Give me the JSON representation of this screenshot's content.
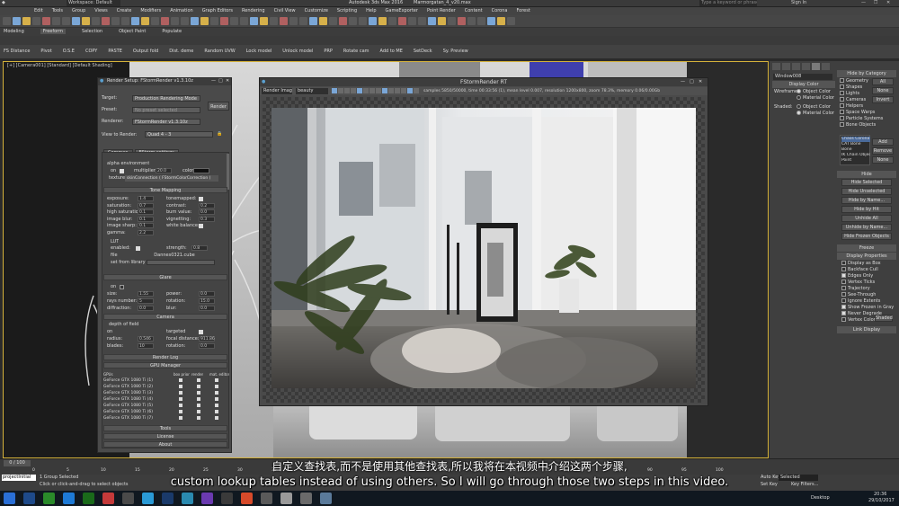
{
  "app": {
    "title": "Autodesk 3ds Max 2016",
    "filename": "Marmorgatan_4_v20.max",
    "workspace": "Workspace: Default",
    "search_placeholder": "Type a keyword or phrase",
    "sign_in": "Sign In"
  },
  "menu": [
    "Edit",
    "Tools",
    "Group",
    "Views",
    "Create",
    "Modifiers",
    "Animation",
    "Graph Editors",
    "Rendering",
    "Civil View",
    "Customize",
    "Scripting",
    "Help",
    "GameExporter",
    "Point Render",
    "Content",
    "Corona",
    "Forest"
  ],
  "ribbon_tabs": [
    "Modeling",
    "Freeform",
    "Selection",
    "Object Paint",
    "Populate"
  ],
  "ribbon_tools": [
    "FS Distance",
    "Pivot",
    "O.S.E",
    "COPY",
    "PASTE",
    "Output fold",
    "Dist. deme",
    "Random UVW",
    "Lock model",
    "Unlock model",
    "PRP",
    "Rotate cam",
    "Add to ME",
    "SetDeck",
    "Sy. Preview"
  ],
  "viewport": {
    "label": "[+] [Camera001] [Standard] [Default Shading]"
  },
  "render_setup": {
    "title": "Render Setup: FStormRender v1.3.10z",
    "target_label": "Target:",
    "target_value": "Production Rendering Mode",
    "preset_label": "Preset:",
    "preset_value": "No preset selected",
    "renderer_label": "Renderer:",
    "renderer_value": "FStormRender v1.3.10z",
    "render_button": "Render",
    "view_label": "View to Render:",
    "view_value": "Quad 4 - 3",
    "tabs": [
      "Common",
      "FStorm settings",
      "Render Elements"
    ],
    "alpha_env": "alpha environment",
    "alpha_on": "on",
    "multiplier_label": "multiplier:",
    "multiplier_value": "20.0",
    "color_label": "color:",
    "texture_label": "texture",
    "texture_value": "skinConnection ( FStormColorCorrection )",
    "tone_mapping": "Tone Mapping",
    "tone_left": [
      {
        "label": "exposure:",
        "value": "1.4"
      },
      {
        "label": "saturation:",
        "value": "0.7"
      },
      {
        "label": "high saturation:",
        "value": "0.1"
      },
      {
        "label": "image blur:",
        "value": "0.1"
      },
      {
        "label": "image sharp:",
        "value": "0.1"
      },
      {
        "label": "gamma:",
        "value": "2.2"
      }
    ],
    "tone_right": [
      {
        "label": "tonemapped:",
        "value": ""
      },
      {
        "label": "contrast:",
        "value": "0.2"
      },
      {
        "label": "burn value:",
        "value": "0.0"
      },
      {
        "label": "vignetting:",
        "value": "0.3"
      },
      {
        "label": "white balance:",
        "value": ""
      }
    ],
    "lut": "LUT",
    "lut_enabled": "enabled:",
    "lut_strength": "strength:",
    "lut_strength_value": "0.8",
    "lut_file_label": "file",
    "lut_file_value": "Dannes0321.cube",
    "lut_library": "set from library",
    "glare": "Glare",
    "glare_on": "on",
    "glare_left": [
      {
        "label": "size:",
        "value": "1.55"
      },
      {
        "label": "rays number:",
        "value": "5"
      },
      {
        "label": "diffraction:",
        "value": "0.0"
      }
    ],
    "glare_right": [
      {
        "label": "power:",
        "value": "0.0"
      },
      {
        "label": "rotation:",
        "value": "15.0"
      },
      {
        "label": "blur:",
        "value": "0.0"
      }
    ],
    "camera": "Camera",
    "dof": "depth of field",
    "cam_left": [
      {
        "label": "on",
        "value": ""
      },
      {
        "label": "radius:",
        "value": "0.546"
      },
      {
        "label": "blades:",
        "value": "10"
      }
    ],
    "cam_right": [
      {
        "label": "targeted",
        "value": ""
      },
      {
        "label": "focal distance:",
        "value": "911.86"
      },
      {
        "label": "rotation:",
        "value": "0.0"
      }
    ],
    "render_log": "Render Log",
    "gpu_manager": "GPU Manager",
    "gpu_header": [
      "GPUs",
      "box prior",
      "render",
      "mat. editor"
    ],
    "gpus": [
      "GeForce GTX 1080 Ti (1)",
      "GeForce GTX 1080 Ti (2)",
      "GeForce GTX 1080 Ti (3)",
      "GeForce GTX 1080 Ti (4)",
      "GeForce GTX 1080 Ti (5)",
      "GeForce GTX 1080 Ti (6)",
      "GeForce GTX 1080 Ti (7)"
    ],
    "tools": "Tools",
    "license": "License",
    "about": "About"
  },
  "fstorm_rt": {
    "title": "FStormRender RT",
    "channel": "Render Image",
    "element": "beauty",
    "stats": "samples 5850/50000, time 00:33:56 (1), mean level 0.007, resolution 1200x800, zoom 78.3%, memory 0.06/0.00Gb"
  },
  "command_panel": {
    "object_name": "Window008",
    "display_color": "Display Color",
    "wireframe": "Wireframe:",
    "object_color": "Object Color",
    "material_color": "Material Color",
    "shaded": "Shaded:",
    "hide_by_category": "Hide by Category",
    "categories": [
      "Geometry",
      "Shapes",
      "Lights",
      "Cameras",
      "Helpers",
      "Space Warps",
      "Particle Systems",
      "Bone Objects"
    ],
    "cat_buttons": [
      "All",
      "None",
      "Invert"
    ],
    "list_items": [
      "Chaos Corona",
      "CAT Bone",
      "Bone",
      "IK Chain Object",
      "Point"
    ],
    "list_buttons": [
      "Add",
      "Remove",
      "None"
    ],
    "hide": "Hide",
    "hide_buttons": [
      "Hide Selected",
      "Hide Unselected",
      "Hide by Name...",
      "Hide by Hit",
      "Unhide All",
      "Unhide by Name...",
      "Hide Frozen Objects"
    ],
    "freeze": "Freeze",
    "display_properties": "Display Properties",
    "props": [
      "Display as Box",
      "Backface Cull",
      "Edges Only",
      "Vertex Ticks",
      "Trajectory",
      "See-Through",
      "Ignore Extents",
      "Show Frozen in Gray",
      "Never Degrade",
      "Vertex Colors"
    ],
    "shaded_btn": "Shaded",
    "link_display": "Link Display"
  },
  "timeline": {
    "frame": "0 / 100",
    "ticks": [
      "0",
      "5",
      "10",
      "15",
      "20",
      "25",
      "30",
      "35",
      "40",
      "45",
      "50",
      "55",
      "60",
      "65",
      "70",
      "75",
      "80",
      "85",
      "90",
      "95",
      "100"
    ]
  },
  "status": {
    "selected": "1 Group Selected",
    "prompt": "Click or click-and-drag to select objects",
    "autokey": "Auto Key",
    "selected_label": "Selected",
    "set_key": "Set Key",
    "key_filters": "Key Filters...",
    "maxscript": "projectInitial"
  },
  "taskbar": {
    "desktop": "Desktop",
    "time": "20:36",
    "date": "29/10/2017"
  },
  "subtitles": {
    "chinese": "自定义查找表,而不是使用其他查找表,所以我将在本视频中介绍这两个步骤,",
    "english": "custom lookup tables instead of using others. So I will go through those two steps in this video."
  },
  "colors": {
    "accent": "#d5b23a",
    "panel": "#3f3f3f",
    "dialog": "#4a4a4a"
  }
}
